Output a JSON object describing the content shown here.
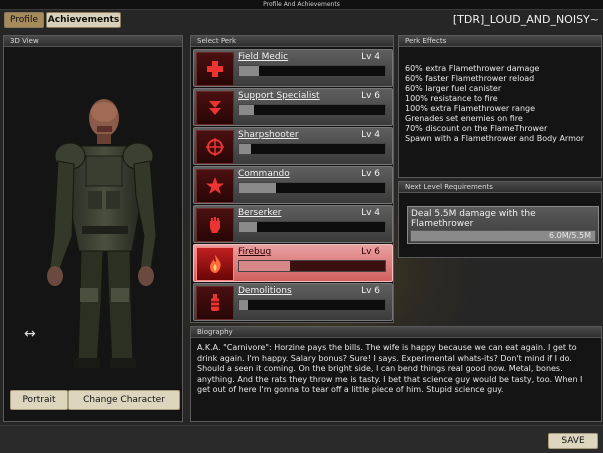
{
  "window": {
    "title": "Profile And Achievements"
  },
  "tabs": [
    {
      "label": "Profile"
    },
    {
      "label": "Achievements"
    }
  ],
  "player": {
    "name": "[TDR]_LOUD_AND_NOISY~"
  },
  "view3d": {
    "header": "3D View",
    "portrait_label": "Portrait",
    "change_character_label": "Change Character"
  },
  "perks": {
    "header": "Select Perk",
    "items": [
      {
        "name": "Field Medic",
        "level": "Lv 4",
        "progress": 0.14,
        "icon": "medic-cross-icon"
      },
      {
        "name": "Support Specialist",
        "level": "Lv 6",
        "progress": 0.1,
        "icon": "support-arrow-icon"
      },
      {
        "name": "Sharpshooter",
        "level": "Lv 4",
        "progress": 0.08,
        "icon": "crosshair-icon"
      },
      {
        "name": "Commando",
        "level": "Lv 6",
        "progress": 0.25,
        "icon": "commando-star-icon"
      },
      {
        "name": "Berserker",
        "level": "Lv 4",
        "progress": 0.12,
        "icon": "fist-icon"
      },
      {
        "name": "Firebug",
        "level": "Lv 6",
        "progress": 0.35,
        "icon": "flame-icon",
        "selected": true
      },
      {
        "name": "Demolitions",
        "level": "Lv 6",
        "progress": 0.06,
        "icon": "grenade-icon"
      }
    ]
  },
  "effects": {
    "header": "Perk Effects",
    "lines": [
      "60% extra Flamethrower damage",
      "60% faster Flamethrower reload",
      "60% larger fuel canister",
      "100% resistance to fire",
      "100% extra Flamethrower range",
      "Grenades set enemies on fire",
      "70% discount on the FlameThrower",
      "Spawn with a Flamethrower and Body Armor"
    ]
  },
  "next_level": {
    "header": "Next Level Requirements",
    "requirement": "Deal 5.5M damage with the Flamethrower",
    "progress_label": "6.0M/5.5M",
    "progress": 1.0
  },
  "biography": {
    "header": "Biography",
    "text": "A.K.A. \"Carnivore\": Horzine pays the bills. The wife is happy because we can eat again. I get to drink again. I'm happy. Salary bonus? Sure! I says. Experimental whats-its? Don't mind if I do. Should a seen it coming. On the bright side, I can bend things real good now. Metal, bones. anything. And the rats they throw me is tasty. I bet that science guy would be tasty, too. When I get out of here I'm gonna to tear off a little piece of him. Stupid science guy."
  },
  "footer": {
    "save_label": "SAVE"
  },
  "colors": {
    "selected_perk": "#d06060",
    "accent": "#a68b5a"
  }
}
